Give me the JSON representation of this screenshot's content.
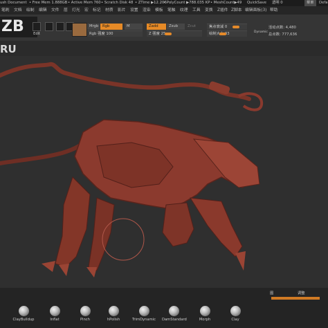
{
  "titlebar": {
    "items": [
      "ush Document",
      "• Free Mem 1.888GB",
      "• Active Mem 760",
      "• Scratch Disk 48",
      "• ZTime ▶12.206",
      "• PolyCount ▶788.035 KP",
      "• MeshCount▶49",
      "QuickSave"
    ],
    "transparency_label": "透明 0",
    "menu_label": "菜单",
    "default_label": "Defau"
  },
  "menubar": {
    "items": [
      "笔刷",
      "文档",
      "绘制",
      "编辑",
      "文件",
      "层",
      "灯光",
      "宏",
      "标记",
      "材质",
      "影片",
      "设置",
      "渲染",
      "模板",
      "笔触",
      "纹理",
      "工具",
      "变换",
      "Z插件",
      "Z脚本",
      "编辑面板(3)",
      "帮助"
    ]
  },
  "toolbar": {
    "logo_text": "ZB霸",
    "tools": [
      "",
      "Edit",
      "",
      "",
      ""
    ],
    "mrgb": "Mrgb",
    "rgb": "Rgb",
    "m": "M",
    "zadd": "Zadd",
    "zsub": "Zsub",
    "zcut": "Zcut",
    "rgb_intensity": "Rgb 强度 100",
    "z_intensity": "Z 强度 25",
    "focal_shift": "焦点衰减 0",
    "draw_size": "绘制大小 33",
    "dynamic": "Dynamic",
    "active_points": "活动点数: 4,480",
    "total_points": "总点数: 777,636"
  },
  "doc_label": "RU",
  "brushes": [
    {
      "label": "ClayBuildup"
    },
    {
      "label": "Inflat"
    },
    {
      "label": "Pinch"
    },
    {
      "label": "hPolish"
    },
    {
      "label": "TrimDynamic"
    },
    {
      "label": "DamStandard"
    },
    {
      "label": "Morph"
    },
    {
      "label": "Clay"
    }
  ],
  "bottom_right": {
    "label1": "图",
    "label2": "调整"
  },
  "colors": {
    "accent": "#e68a26",
    "model": "#8a3a2e",
    "background": "#2f2f2f"
  }
}
